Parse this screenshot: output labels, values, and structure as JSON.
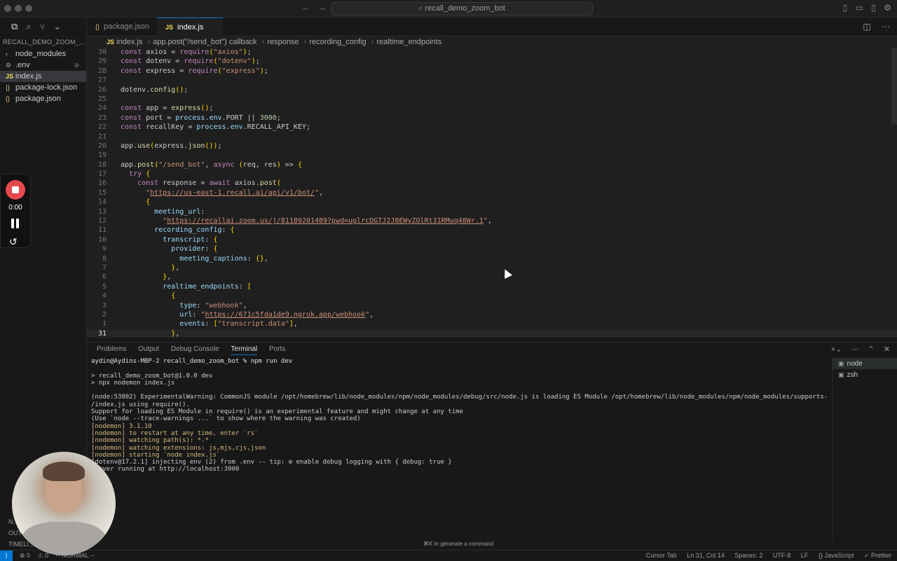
{
  "titlebar": {
    "search": "recall_demo_zoom_bot"
  },
  "sidebar": {
    "title": "RECALL_DEMO_ZOOM_...",
    "items": [
      {
        "label": "node_modules",
        "icon": "chevron-right-icon",
        "type": "folder"
      },
      {
        "label": ".env",
        "icon": "gear-icon",
        "type": "file",
        "badge": "⊘"
      },
      {
        "label": "index.js",
        "icon": "js-icon",
        "type": "file",
        "active": true
      },
      {
        "label": "package-lock.json",
        "icon": "json-icon",
        "type": "file"
      },
      {
        "label": "package.json",
        "icon": "json-icon",
        "type": "file"
      }
    ],
    "bottom": [
      "N…",
      "OUT…",
      "TIMELI…"
    ]
  },
  "recorder": {
    "time": "0:00"
  },
  "tabs": [
    {
      "label": "package.json",
      "icon": "{}"
    },
    {
      "label": "index.js",
      "icon": "JS",
      "active": true
    }
  ],
  "breadcrumb": {
    "file": "index.js",
    "items": [
      "app.post(\"/send_bot\") callback",
      "response",
      "recording_config",
      "realtime_endpoints"
    ]
  },
  "editor": {
    "current_line": 31,
    "lines": [
      {
        "n": 30,
        "code": "const axios = require(\"axios\");"
      },
      {
        "n": 29,
        "code": "const dotenv = require(\"dotenv\");"
      },
      {
        "n": 28,
        "code": "const express = require(\"express\");"
      },
      {
        "n": 27,
        "code": ""
      },
      {
        "n": 26,
        "code": "dotenv.config();"
      },
      {
        "n": 25,
        "code": ""
      },
      {
        "n": 24,
        "code": "const app = express();"
      },
      {
        "n": 23,
        "code": "const port = process.env.PORT || 3000;"
      },
      {
        "n": 22,
        "code": "const recallKey = process.env.RECALL_API_KEY;"
      },
      {
        "n": 21,
        "code": ""
      },
      {
        "n": 20,
        "code": "app.use(express.json());"
      },
      {
        "n": 19,
        "code": ""
      },
      {
        "n": 18,
        "code": "app.post(\"/send_bot\", async (req, res) => {"
      },
      {
        "n": 17,
        "code": "  try {"
      },
      {
        "n": 16,
        "code": "    const response = await axios.post("
      },
      {
        "n": 15,
        "code": "      \"https://us-east-1.recall.ai/api/v1/bot/\","
      },
      {
        "n": 14,
        "code": "      {"
      },
      {
        "n": 13,
        "code": "        meeting_url:"
      },
      {
        "n": 12,
        "code": "          \"https://recallai.zoom.us/j/81189201489?pwd=uglrcDGTJ2J8EWyZOlRt31RMuq48Wr.1\","
      },
      {
        "n": 11,
        "code": "        recording_config: {"
      },
      {
        "n": 10,
        "code": "          transcript: {"
      },
      {
        "n": 9,
        "code": "            provider: {"
      },
      {
        "n": 8,
        "code": "              meeting_captions: {},"
      },
      {
        "n": 7,
        "code": "            },"
      },
      {
        "n": 6,
        "code": "          },"
      },
      {
        "n": 5,
        "code": "          realtime_endpoints: ["
      },
      {
        "n": 4,
        "code": "            {"
      },
      {
        "n": 3,
        "code": "              type: \"webhook\","
      },
      {
        "n": 2,
        "code": "              url: \"https://671c5fda1de9.ngrok.app/webhook\","
      },
      {
        "n": 1,
        "code": "              events: [\"transcript.data\"],"
      },
      {
        "n": 31,
        "code": "            },"
      }
    ]
  },
  "panel": {
    "tabs": [
      "Problems",
      "Output",
      "Debug Console",
      "Terminal",
      "Ports"
    ],
    "active_tab": "Terminal",
    "terminals": [
      {
        "label": "node",
        "active": true
      },
      {
        "label": "zsh"
      }
    ],
    "lines": [
      {
        "text": "aydin@Aydins-MBP-2 recall_demo_zoom_bot % npm run dev",
        "kind": "prompt"
      },
      {
        "text": "",
        "kind": ""
      },
      {
        "text": "> recall_demo_zoom_bot@1.0.0 dev",
        "kind": ""
      },
      {
        "text": "> npx nodemon index.js",
        "kind": ""
      },
      {
        "text": "",
        "kind": ""
      },
      {
        "text": "(node:53802) ExperimentalWarning: CommonJS module /opt/homebrew/lib/node_modules/npm/node_modules/debug/src/node.js is loading ES Module /opt/homebrew/lib/node_modules/npm/node_modules/supports-color",
        "kind": ""
      },
      {
        "text": "/index.js using require().",
        "kind": ""
      },
      {
        "text": "Support for loading ES Module in require() is an experimental feature and might change at any time",
        "kind": ""
      },
      {
        "text": "(Use `node --trace-warnings ...` to show where the warning was created)",
        "kind": ""
      },
      {
        "text": "[nodemon] 3.1.10",
        "kind": "nodemon"
      },
      {
        "text": "[nodemon] to restart at any time, enter `rs`",
        "kind": "nodemon"
      },
      {
        "text": "[nodemon] watching path(s): *.*",
        "kind": "nodemon"
      },
      {
        "text": "[nodemon] watching extensions: js,mjs,cjs,json",
        "kind": "nodemon"
      },
      {
        "text": "[nodemon] starting `node index.js`",
        "kind": "nodemon"
      },
      {
        "text": "[dotenv@17.2.1] injecting env (2) from .env -- tip: ⚙ enable debug logging with { debug: true }",
        "kind": ""
      },
      {
        "text": "Server running at http://localhost:3000",
        "kind": ""
      }
    ],
    "hint": "⌘K to generate a command"
  },
  "statusbar": {
    "left": [
      "⊗ 0",
      "⚠ 0",
      "-- NORMAL --"
    ],
    "right": [
      "Cursor Tab",
      "Ln 31, Col 14",
      "Spaces: 2",
      "UTF-8",
      "LF",
      "{} JavaScript",
      "✓ Prettier"
    ]
  }
}
